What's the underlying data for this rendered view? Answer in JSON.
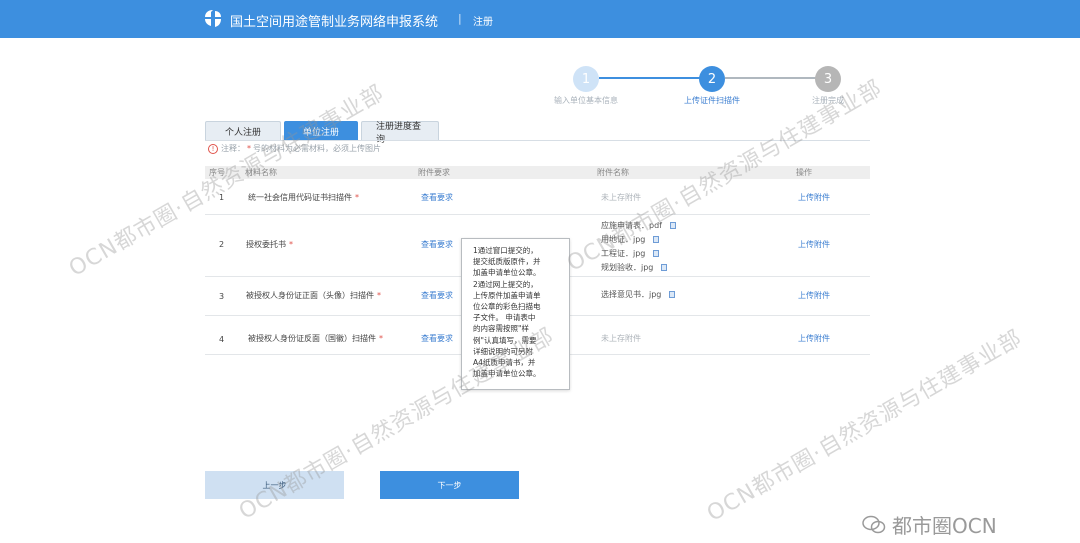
{
  "header": {
    "app_title": "国土空间用途管制业务网络申报系统",
    "separator": "|",
    "page_name": "注册",
    "color": "#3d8fdf"
  },
  "steps": [
    {
      "number": "1",
      "label": "输入单位基本信息",
      "state": "done"
    },
    {
      "number": "2",
      "label": "上传证件扫描件",
      "state": "current"
    },
    {
      "number": "3",
      "label": "注册完成",
      "state": "pending"
    }
  ],
  "tabs": [
    {
      "label": "个人注册",
      "active": false
    },
    {
      "label": "单位注册",
      "active": true
    },
    {
      "label": "注册进度查询",
      "active": false
    }
  ],
  "notice": {
    "prefix": "注释：",
    "star": "*",
    "text": "号的材料为必需材料，必须上传图片"
  },
  "table": {
    "headers": [
      "序号",
      "材料名称",
      "附件要求",
      "附件名称",
      "操作"
    ],
    "rows": [
      {
        "index": "1",
        "name": "统一社会信用代码证书扫描件",
        "required": "*",
        "requirement_link": "查看要求",
        "files": [],
        "empty_text": "未上存附件",
        "action": "上传附件"
      },
      {
        "index": "2",
        "name": "授权委托书",
        "required": "*",
        "requirement_link": "查看要求",
        "files": [
          "应施申请表．pdf",
          "用地证．jpg",
          "工程证．jpg",
          "规划验收．jpg"
        ],
        "empty_text": "",
        "action": "上传附件"
      },
      {
        "index": "3",
        "name": "被授权人身份证正面（头像）扫描件",
        "required": "*",
        "requirement_link": "查看要求",
        "files": [
          "选择意见书．jpg"
        ],
        "empty_text": "",
        "action": "上传附件"
      },
      {
        "index": "4",
        "name": "被授权人身份证反面（国徽）扫描件",
        "required": "*",
        "requirement_link": "查看要求",
        "files": [],
        "empty_text": "未上存附件",
        "action": "上传附件"
      }
    ]
  },
  "tooltip": {
    "lines": [
      "1通过窗口提交的，",
      "提交纸质版原件，并",
      "加盖申请单位公章。",
      "2通过网上提交的，",
      "上传原件加盖申请单",
      "位公章的彩色扫描电",
      "子文件。 申请表中",
      "的内容需按照\"样",
      "例\"认真填写，需要",
      "详细说明的可另附",
      "A4纸质申请书，并",
      "加盖申请单位公章。"
    ]
  },
  "buttons": {
    "prev": "上一步",
    "next": "下一步"
  },
  "watermarks": {
    "text_a": "OCN都市圈·自然资源与住建事业部",
    "text_b": "都市圈OCN"
  }
}
